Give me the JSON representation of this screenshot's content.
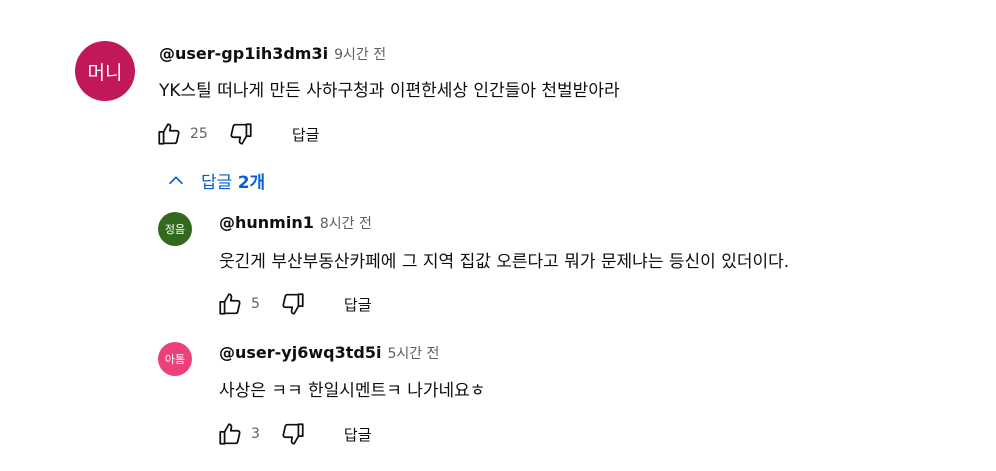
{
  "comments": [
    {
      "avatar_text": "머니",
      "avatar_color": "#c1185b",
      "author": "@user-gp1ih3dm3i",
      "time": "9시간 전",
      "text": "YK스틸  떠나게 만든 사하구청과 이편한세상 인간들아 천벌받아라",
      "likes": "25",
      "reply_label": "답글"
    }
  ],
  "replies_toggle": {
    "prefix": "답글 ",
    "count": "2개"
  },
  "replies": [
    {
      "avatar_text": "정음",
      "avatar_color": "#33691e",
      "author": "@hunmin1",
      "time": "8시간 전",
      "text": "웃긴게 부산부동산카페에 그 지역 집값 오른다고 뭐가 문제냐는 등신이 있더이다.",
      "likes": "5",
      "reply_label": "답글"
    },
    {
      "avatar_text": "아톰",
      "avatar_color": "#ec407a",
      "author": "@user-yj6wq3td5i",
      "time": "5시간 전",
      "text": "사상은 ㅋㅋ 한일시멘트ㅋ 나가네요ㅎ",
      "likes": "3",
      "reply_label": "답글"
    }
  ]
}
